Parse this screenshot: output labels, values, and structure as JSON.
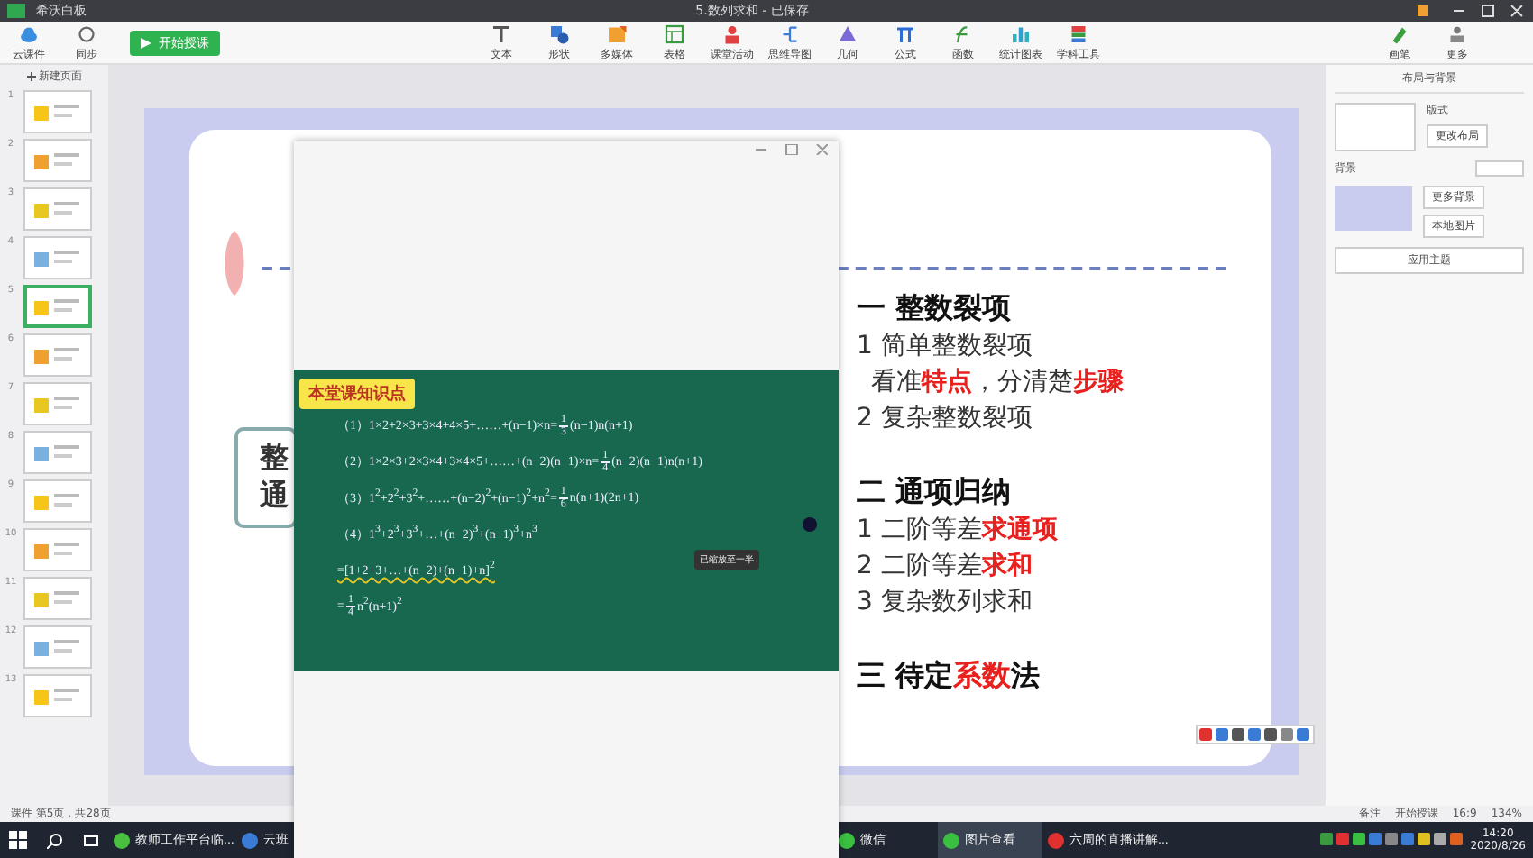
{
  "title_bar": {
    "app_name": "希沃白板",
    "document_title": "5.数列求和 - 已保存"
  },
  "toolbar": {
    "left": [
      {
        "label": "云课件"
      },
      {
        "label": "同步"
      }
    ],
    "start_button": "开始授课",
    "tools": [
      {
        "label": "文本"
      },
      {
        "label": "形状"
      },
      {
        "label": "多媒体"
      },
      {
        "label": "表格"
      },
      {
        "label": "课堂活动"
      },
      {
        "label": "思维导图"
      },
      {
        "label": "几何"
      },
      {
        "label": "公式"
      },
      {
        "label": "函数"
      },
      {
        "label": "统计图表"
      },
      {
        "label": "学科工具"
      }
    ],
    "right": [
      {
        "label": "画笔"
      },
      {
        "label": "更多"
      }
    ]
  },
  "pages": {
    "new_page": "新建页面",
    "items": [
      {
        "number": "1",
        "selected": false
      },
      {
        "number": "2",
        "selected": false
      },
      {
        "number": "3",
        "selected": false
      },
      {
        "number": "4",
        "selected": false
      },
      {
        "number": "5",
        "selected": true
      },
      {
        "number": "6",
        "selected": false
      },
      {
        "number": "7",
        "selected": false
      },
      {
        "number": "8",
        "selected": false
      },
      {
        "number": "9",
        "selected": false
      },
      {
        "number": "10",
        "selected": false
      },
      {
        "number": "11",
        "selected": false
      },
      {
        "number": "12",
        "selected": false
      },
      {
        "number": "13",
        "selected": false
      }
    ]
  },
  "slide": {
    "left_box": [
      "整",
      "通"
    ],
    "outline": [
      {
        "kind": "heading",
        "parts": [
          {
            "text": "一 整数裂项",
            "highlight": false
          }
        ]
      },
      {
        "kind": "item",
        "parts": [
          {
            "text": "1 简单整数裂项",
            "highlight": false
          }
        ]
      },
      {
        "kind": "note",
        "parts": [
          {
            "text": "看准",
            "highlight": false
          },
          {
            "text": "特点",
            "highlight": true
          },
          {
            "text": "，分清楚",
            "highlight": false
          },
          {
            "text": "步骤",
            "highlight": true
          }
        ]
      },
      {
        "kind": "item",
        "parts": [
          {
            "text": "2 复杂整数裂项",
            "highlight": false
          }
        ]
      },
      {
        "kind": "heading",
        "parts": [
          {
            "text": "二 通项归纳",
            "highlight": false
          }
        ]
      },
      {
        "kind": "item",
        "parts": [
          {
            "text": "1 二阶等差",
            "highlight": false
          },
          {
            "text": "求通项",
            "highlight": true
          }
        ]
      },
      {
        "kind": "item",
        "parts": [
          {
            "text": "2 二阶等差",
            "highlight": false
          },
          {
            "text": "求和",
            "highlight": true
          }
        ]
      },
      {
        "kind": "item",
        "parts": [
          {
            "text": "3 复杂数列求和",
            "highlight": false
          }
        ]
      },
      {
        "kind": "heading",
        "parts": [
          {
            "text": "三 待定",
            "highlight": false
          },
          {
            "text": "系数",
            "highlight": true
          },
          {
            "text": "法",
            "highlight": false
          }
        ]
      }
    ]
  },
  "popup": {
    "board_title": "本堂课知识点",
    "tooltip": "已缩放至一半",
    "formulas": [
      {
        "parts": [
          {
            "text": "（1）1×2+2×3+3×4+4×5+……+(n−1)×n="
          },
          {
            "num": "1",
            "den": "3"
          },
          {
            "text": "(n−1)n(n+1)"
          }
        ]
      },
      {
        "parts": [
          {
            "text": "（2）1×2×3+2×3×4+3×4×5+……+(n−2)(n−1)×n="
          },
          {
            "num": "1",
            "den": "4"
          },
          {
            "text": "(n−2)(n−1)n(n+1)"
          }
        ]
      },
      {
        "parts": [
          {
            "text": "（3）1$^{2}$+2$^{2}$+3$^{2}$+……+(n−2)$^{2}$+(n−1)$^{2}$+n$^{2}$="
          },
          {
            "num": "1",
            "den": "6"
          },
          {
            "text": "n(n+1)(2n+1)"
          }
        ]
      },
      {
        "parts": [
          {
            "text": "（4）1$^{3}$+2$^{3}$+3$^{3}$+…+(n−2)$^{3}$+(n−1)$^{3}$+n$^{3}$"
          }
        ]
      },
      {
        "parts": [
          {
            "text": "=[1+2+3+…+(n−2)+(n−1)+n]$^{2}$"
          }
        ]
      },
      {
        "parts": [
          {
            "text": "="
          },
          {
            "num": "1",
            "den": "4"
          },
          {
            "text": "n$^{2}$(n+1)$^{2}$"
          }
        ]
      }
    ]
  },
  "right_panel": {
    "tab": "布局与背景",
    "layout_label": "版式",
    "change_layout": "更改布局",
    "background_label": "背景",
    "more_backgrounds": "更多背景",
    "local_image": "本地图片",
    "apply_theme": "应用主题"
  },
  "status_bar": {
    "page_info": "课件 第5页，共28页",
    "notes": "备注",
    "start": "开始授课",
    "ratio": "16:9",
    "zoom": "134%"
  },
  "taskbar": {
    "apps_left": [
      {
        "label": "教师工作平台临...",
        "selected": false
      },
      {
        "label": "云班",
        "selected": false
      }
    ],
    "apps_right": [
      {
        "label": "微信",
        "selected": false
      },
      {
        "label": "图片查看",
        "selected": true
      },
      {
        "label": "六周的直播讲解...",
        "selected": false
      }
    ],
    "time": "14:20",
    "date": "2020/8/26"
  }
}
